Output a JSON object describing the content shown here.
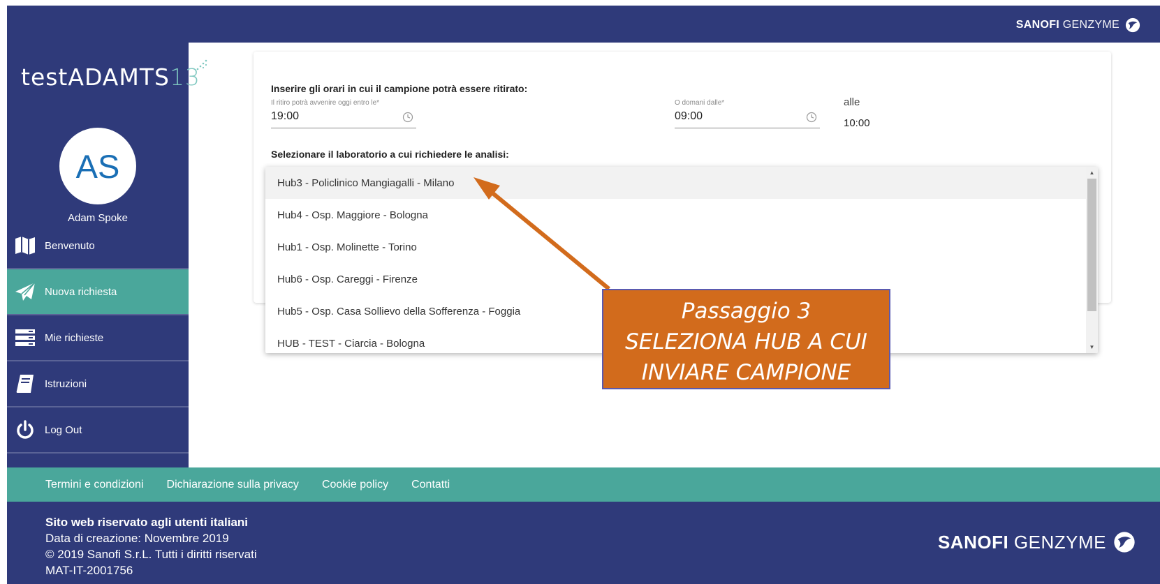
{
  "header": {
    "brand_bold": "SANOFI",
    "brand_light": "GENZYME"
  },
  "sidebar": {
    "logo_text": "testADAMTS",
    "logo_num": "13",
    "avatar_initials": "AS",
    "user_name": "Adam Spoke",
    "items": [
      {
        "label": "Benvenuto",
        "icon": "map-icon"
      },
      {
        "label": "Nuova richiesta",
        "icon": "paper-plane-icon",
        "active": true
      },
      {
        "label": "Mie richieste",
        "icon": "list-icon"
      },
      {
        "label": "Istruzioni",
        "icon": "book-icon"
      },
      {
        "label": "Log Out",
        "icon": "power-icon"
      }
    ]
  },
  "form": {
    "times_title": "Inserire gli orari in cui il campione potrà essere ritirato:",
    "today_label": "Il ritiro potrà avvenire oggi entro le*",
    "today_value": "19:00",
    "tomorrow_label": "O domani dalle*",
    "tomorrow_value": "09:00",
    "until_label": "alle",
    "until_value": "10:00",
    "lab_title": "Selezionare il laboratorio a cui richiedere le analisi:",
    "lab_options": [
      "Hub3 - Policlinico Mangiagalli - Milano",
      "Hub4 - Osp. Maggiore - Bologna",
      "Hub1 - Osp. Molinette - Torino",
      "Hub6 - Osp. Careggi - Firenze",
      "Hub5 - Osp. Casa Sollievo della Sofferenza - Foggia",
      "HUB - TEST - Ciarcia - Bologna"
    ]
  },
  "annotation": {
    "line1": "Passaggio 3",
    "line2": "SELEZIONA HUB A CUI",
    "line3": "INVIARE CAMPIONE",
    "color": "#d26b1c"
  },
  "footer": {
    "links": [
      "Termini e condizioni",
      "Dichiarazione sulla privacy",
      "Cookie policy",
      "Contatti"
    ],
    "line1": "Sito web riservato agli utenti italiani",
    "line2": "Data di creazione: Novembre 2019",
    "line3": "© 2019 Sanofi S.r.L. Tutti i diritti riservati",
    "line4": "MAT-IT-2001756"
  },
  "colors": {
    "navy": "#2f3a7a",
    "teal": "#4aa79b",
    "accent_orange": "#d26b1c"
  }
}
